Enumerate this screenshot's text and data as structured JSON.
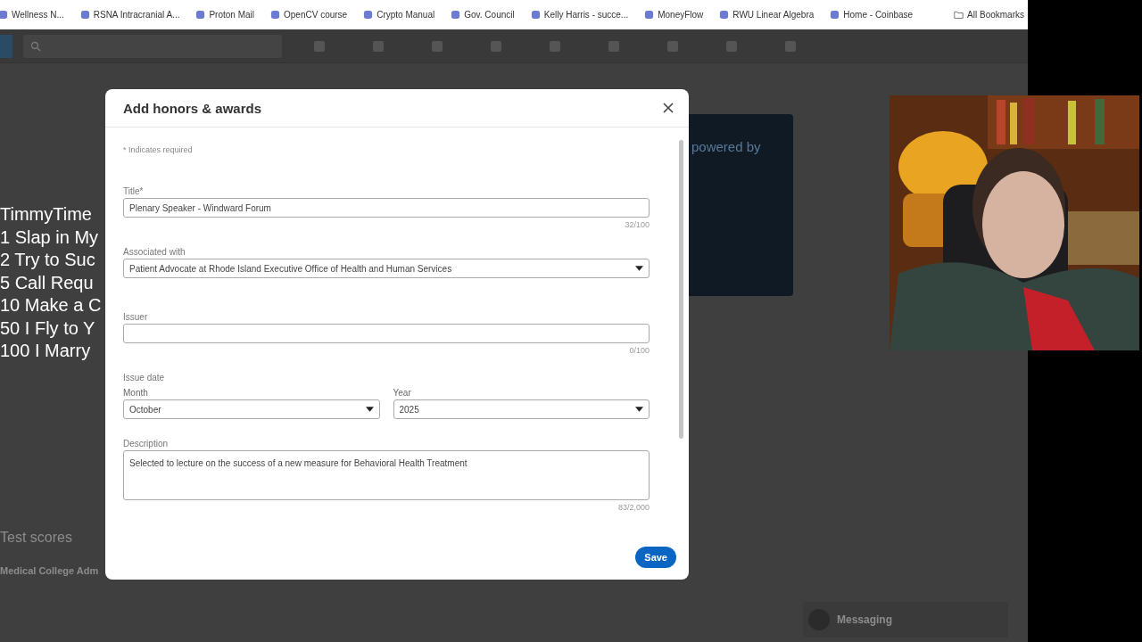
{
  "bookmarks": [
    {
      "label": "Wellness N..."
    },
    {
      "label": "RSNA Intracranial A..."
    },
    {
      "label": "Proton Mail"
    },
    {
      "label": "OpenCV course"
    },
    {
      "label": "Crypto Manual"
    },
    {
      "label": "Gov. Council"
    },
    {
      "label": "Kelly Harris - succe..."
    },
    {
      "label": "MoneyFlow"
    },
    {
      "label": "RWU Linear Algebra"
    },
    {
      "label": "Home - Coinbase"
    }
  ],
  "all_bookmarks": "All Bookmarks",
  "background": {
    "promo_text": "powered by",
    "section_title": "Test scores",
    "item_title": "Medical College Adm",
    "messaging": "Messaging"
  },
  "stream_overlay": {
    "lines": [
      "TimmyTime",
      "1 Slap in My",
      "2 Try to Suc",
      "5 Call Requ",
      "10 Make a C",
      "50 I Fly to Y",
      "100 I Marry"
    ]
  },
  "dialog": {
    "title": "Add honors & awards",
    "required_note": "* Indicates required",
    "fields": [
      {
        "kind": "text",
        "label": "Title*",
        "value": "Plenary Speaker - Windward Forum",
        "counter": "32/100"
      },
      {
        "kind": "select",
        "label": "Associated with",
        "value": "Patient Advocate at Rhode Island Executive Office of Health and Human Services"
      },
      {
        "kind": "text",
        "label": "Issuer",
        "counter": "0/100"
      },
      {
        "kind": "date",
        "label": "Issue date",
        "parts": [
          {
            "label": "Month",
            "value": "October"
          },
          {
            "label": "Year",
            "value": "2025"
          }
        ]
      },
      {
        "kind": "textarea",
        "label": "Description",
        "value": "Selected to lecture on the success of a new measure for Behavioral Health Treatment",
        "counter": "83/2,000"
      }
    ],
    "save": "Save"
  }
}
